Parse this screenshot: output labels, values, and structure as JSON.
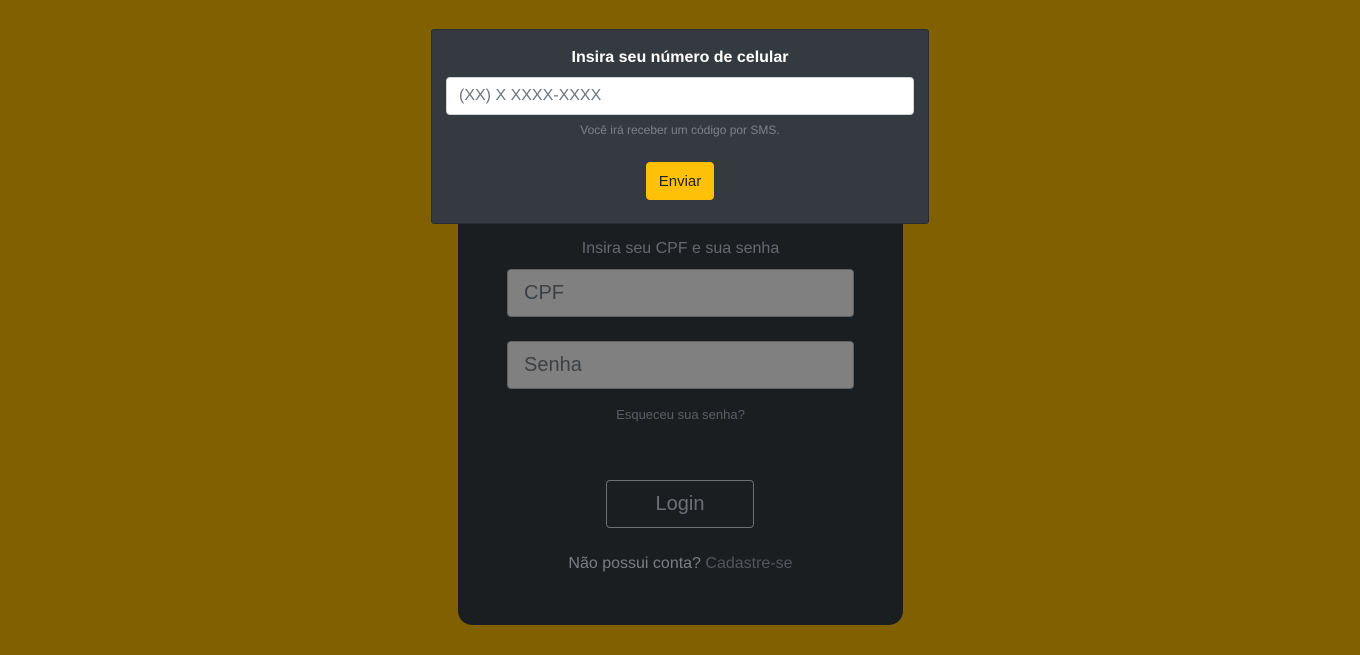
{
  "colors": {
    "page_background": "#806000",
    "card_background": "#1b1e21",
    "modal_background": "#343a40",
    "accent": "#ffc107"
  },
  "login": {
    "instructions": "Insira seu CPF e sua senha",
    "cpf_placeholder": "CPF",
    "senha_placeholder": "Senha",
    "forgot_password": "Esqueceu sua senha?",
    "login_button": "Login",
    "no_account_text": "Não possui conta?",
    "signup_link": "Cadastre-se"
  },
  "modal": {
    "title": "Insira seu número de celular",
    "phone_placeholder": "(XX) X XXXX-XXXX",
    "helper_text": "Você irá receber um código por SMS.",
    "send_button": "Enviar"
  }
}
